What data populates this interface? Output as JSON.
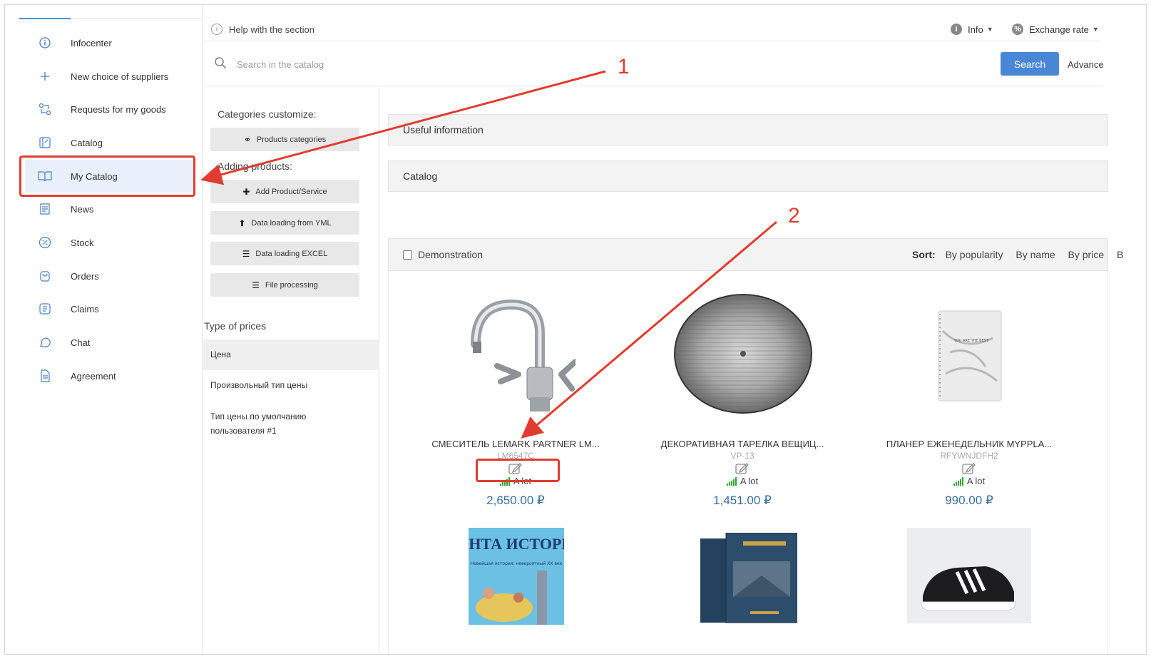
{
  "sidebar": {
    "items": [
      {
        "label": "Infocenter",
        "icon": "info-circle-icon"
      },
      {
        "label": "New choice of suppliers",
        "icon": "plus-icon"
      },
      {
        "label": "Requests for my goods",
        "icon": "exchange-icon"
      },
      {
        "label": "Catalog",
        "icon": "catalog-icon"
      },
      {
        "label": "My Catalog",
        "icon": "open-book-icon"
      },
      {
        "label": "News",
        "icon": "news-icon"
      },
      {
        "label": "Stock",
        "icon": "percent-icon"
      },
      {
        "label": "Orders",
        "icon": "bag-icon"
      },
      {
        "label": "Claims",
        "icon": "claims-icon"
      },
      {
        "label": "Chat",
        "icon": "chat-icon"
      },
      {
        "label": "Agreement",
        "icon": "document-icon"
      }
    ]
  },
  "header": {
    "help": "Help with the section",
    "info": "Info",
    "exchange_rate": "Exchange rate"
  },
  "search": {
    "placeholder": "Search in the catalog",
    "button": "Search",
    "advance": "Advance"
  },
  "middle": {
    "categories_title": "Categories customize:",
    "products_categories": "Products categories",
    "adding_title": "Adding products:",
    "add_product": "Add Product/Service",
    "yml": "Data loading from YML",
    "excel": "Data loading EXCEL",
    "file_processing": "File processing",
    "type_of_prices": "Type of prices",
    "prices": [
      "Цена",
      "Произвольный тип цены",
      "Тип цены по умолчанию пользователя #1"
    ]
  },
  "main": {
    "useful_info": "Useful information",
    "catalog": "Catalog",
    "demonstration": "Demonstration",
    "sort_label": "Sort:",
    "sort_options": [
      "By popularity",
      "By name",
      "By price",
      "B"
    ],
    "products": [
      {
        "name": "СМЕСИТЕЛЬ LEMARK PARTNER LM...",
        "sku": "LM6547C",
        "stock": "A lot",
        "price": "2,650.00 ₽"
      },
      {
        "name": "ДЕКОРАТИВНАЯ ТАРЕЛКА ВЕЩИЦ...",
        "sku": "VP-13",
        "stock": "A lot",
        "price": "1,451.00 ₽"
      },
      {
        "name": "ПЛАНЕР ЕЖЕНЕДЕЛЬНИК MYPPLA...",
        "sku": "RFYWNJDFH2",
        "stock": "A lot",
        "price": "990.00 ₽"
      }
    ],
    "book_cover_title": "ЛЕНТА ИСТОРИИ",
    "book_cover_subtitle": "Новейшая история: невероятный XX век",
    "planner_text": "YOU ARE THE BEST"
  },
  "annotations": {
    "one": "1",
    "two": "2"
  },
  "colors": {
    "accent": "#4a86d6",
    "annotation": "#e03c31",
    "price": "#3b6e9c",
    "stock": "#2fa52f"
  }
}
